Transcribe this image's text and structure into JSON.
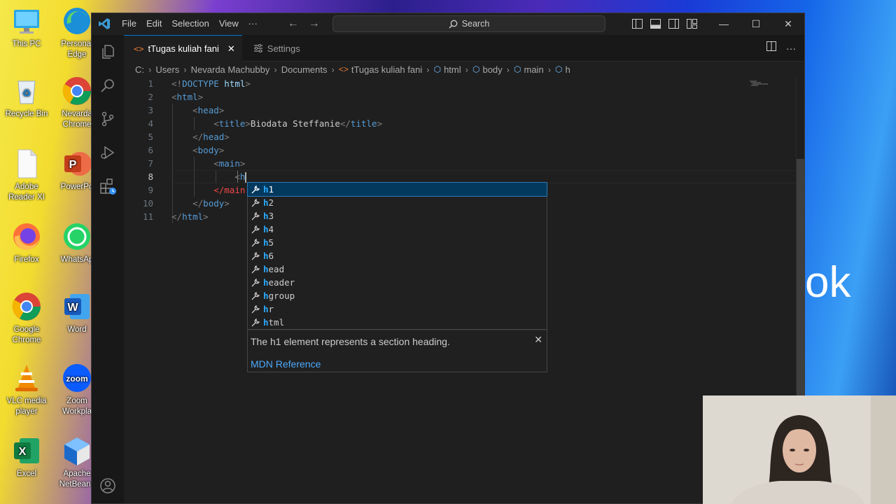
{
  "desktop": {
    "icons_col1": [
      {
        "label": "This PC"
      },
      {
        "label": "Recycle Bin"
      },
      {
        "label": "Adobe Reader XI"
      },
      {
        "label": "Firefox"
      },
      {
        "label": "Google Chrome"
      },
      {
        "label": "VLC media player"
      },
      {
        "label": "Excel"
      }
    ],
    "icons_col2": [
      {
        "label": "Personal Edge"
      },
      {
        "label": "Nevarda Chrome"
      },
      {
        "label": "PowerPo"
      },
      {
        "label": "WhatsAp"
      },
      {
        "label": "Word"
      },
      {
        "label": "Zoom Workpla"
      },
      {
        "label": "Apache NetBeans"
      }
    ],
    "right_text": "ok"
  },
  "window": {
    "menu": [
      "File",
      "Edit",
      "Selection",
      "View",
      "···"
    ],
    "search_label": "Search",
    "controls": {
      "minimize": "—",
      "maximize": "☐",
      "close": "✕"
    }
  },
  "tabs": [
    {
      "label": "tTugas kuliah fani",
      "active": true,
      "close": "✕"
    },
    {
      "label": "Settings",
      "active": false
    }
  ],
  "breadcrumb": [
    "C:",
    "Users",
    "Nevarda Machubby",
    "Documents",
    "tTugas kuliah fani",
    "html",
    "body",
    "main",
    "h"
  ],
  "editor": {
    "lines": [
      {
        "n": "1",
        "text": "<!DOCTYPE html>"
      },
      {
        "n": "2",
        "text": "<html>"
      },
      {
        "n": "3",
        "text": "<head>"
      },
      {
        "n": "4",
        "text": "<title>Biodata Steffanie</title>"
      },
      {
        "n": "5",
        "text": "</head>"
      },
      {
        "n": "6",
        "text": "<body>"
      },
      {
        "n": "7",
        "text": "<main>"
      },
      {
        "n": "8",
        "text": "<h"
      },
      {
        "n": "9",
        "text": "</main"
      },
      {
        "n": "10",
        "text": "</body>"
      },
      {
        "n": "11",
        "text": "</html>"
      }
    ]
  },
  "suggest": {
    "items": [
      {
        "hl": "h",
        "rest": "1"
      },
      {
        "hl": "h",
        "rest": "2"
      },
      {
        "hl": "h",
        "rest": "3"
      },
      {
        "hl": "h",
        "rest": "4"
      },
      {
        "hl": "h",
        "rest": "5"
      },
      {
        "hl": "h",
        "rest": "6"
      },
      {
        "hl": "h",
        "rest": "ead"
      },
      {
        "hl": "h",
        "rest": "eader"
      },
      {
        "hl": "h",
        "rest": "group"
      },
      {
        "hl": "h",
        "rest": "r"
      },
      {
        "hl": "h",
        "rest": "tml"
      }
    ],
    "detail": "The h1 element represents a section heading.",
    "reference": "MDN Reference",
    "close": "✕"
  },
  "colors": {
    "accent": "#0078d4",
    "tag": "#569cd6",
    "suggest_selected": "#04395e"
  }
}
